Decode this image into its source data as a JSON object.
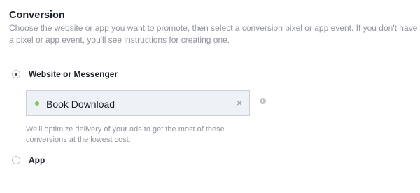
{
  "section": {
    "title": "Conversion",
    "description": "Choose the website or app you want to promote, then select a conversion pixel or app event. If you don't have a pixel or app event, you'll see instructions for creating one."
  },
  "options": {
    "website": {
      "label": "Website or Messenger",
      "selected": true
    },
    "app": {
      "label": "App",
      "selected": false
    }
  },
  "pixel": {
    "name": "Book Download",
    "status_color": "#7fc75a",
    "remove_icon": "×",
    "info_icon": "i"
  },
  "helper_text": "We'll optimize delivery of your ads to get the most of these conversions at the lowest cost.",
  "colors": {
    "text": "#1d2129",
    "muted": "#90949c",
    "box_bg": "#eef1f6",
    "box_border": "#ccd0d5"
  }
}
